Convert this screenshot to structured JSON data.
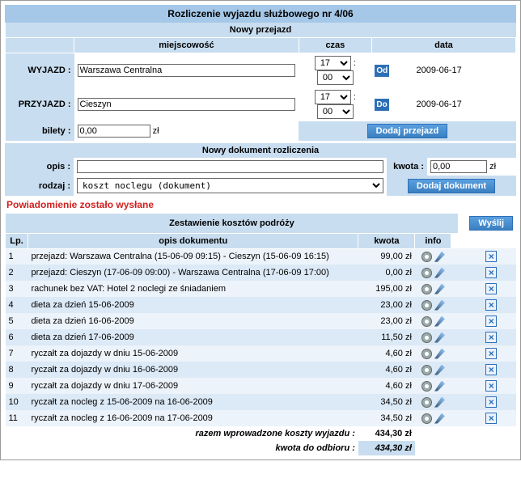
{
  "title": "Rozliczenie wyjazdu służbowego nr 4/06",
  "section_przejazd": "Nowy przejazd",
  "cols": {
    "miejscowosc": "miejscowość",
    "czas": "czas",
    "data": "data"
  },
  "rows": {
    "wyjazd_lbl": "WYJAZD :",
    "wyjazd_val": "Warszawa Centralna",
    "wyjazd_h": "17",
    "wyjazd_m": "00",
    "wyjazd_badge": "Od",
    "wyjazd_date": "2009-06-17",
    "przyjazd_lbl": "PRZYJAZD :",
    "przyjazd_val": "Cieszyn",
    "przyjazd_h": "17",
    "przyjazd_m": "00",
    "przyjazd_badge": "Do",
    "przyjazd_date": "2009-06-17"
  },
  "bilety_lbl": "bilety :",
  "bilety_val": "0,00",
  "zl": "zł",
  "btn_dodaj_przejazd": "Dodaj przejazd",
  "section_dok": "Nowy dokument rozliczenia",
  "opis_lbl": "opis :",
  "opis_val": "",
  "kwota_lbl": "kwota :",
  "kwota_val": "0,00",
  "rodzaj_lbl": "rodzaj :",
  "rodzaj_val": "koszt noclegu (dokument)",
  "btn_dodaj_dok": "Dodaj dokument",
  "notice": "Powiadomienie zostało wysłane",
  "section_zestawienie": "Zestawienie kosztów podróży",
  "btn_wyslij": "Wyślij",
  "thead": {
    "lp": "Lp.",
    "opis": "opis dokumentu",
    "kwota": "kwota",
    "info": "info"
  },
  "items": [
    {
      "lp": "1",
      "opis": "przejazd: Warszawa Centralna (15-06-09 09:15) - Cieszyn (15-06-09 16:15)",
      "kwota": "99,00 zł"
    },
    {
      "lp": "2",
      "opis": "przejazd: Cieszyn (17-06-09 09:00) - Warszawa Centralna (17-06-09 17:00)",
      "kwota": "0,00 zł"
    },
    {
      "lp": "3",
      "opis": "rachunek bez VAT: Hotel 2 noclegi ze śniadaniem",
      "kwota": "195,00 zł"
    },
    {
      "lp": "4",
      "opis": "dieta za dzień 15-06-2009",
      "kwota": "23,00 zł"
    },
    {
      "lp": "5",
      "opis": "dieta za dzień 16-06-2009",
      "kwota": "23,00 zł"
    },
    {
      "lp": "6",
      "opis": "dieta za dzień 17-06-2009",
      "kwota": "11,50 zł"
    },
    {
      "lp": "7",
      "opis": "ryczałt za dojazdy w dniu 15-06-2009",
      "kwota": "4,60 zł"
    },
    {
      "lp": "8",
      "opis": "ryczałt za dojazdy w dniu 16-06-2009",
      "kwota": "4,60 zł"
    },
    {
      "lp": "9",
      "opis": "ryczałt za dojazdy w dniu 17-06-2009",
      "kwota": "4,60 zł"
    },
    {
      "lp": "10",
      "opis": "ryczałt za nocleg z 15-06-2009 na 16-06-2009",
      "kwota": "34,50 zł"
    },
    {
      "lp": "11",
      "opis": "ryczałt za nocleg z 16-06-2009 na 17-06-2009",
      "kwota": "34,50 zł"
    }
  ],
  "sum1_lbl": "razem wprowadzone koszty wyjazdu :",
  "sum1_val": "434,30 zł",
  "sum2_lbl": "kwota do odbioru :",
  "sum2_val": "434,30 zł"
}
